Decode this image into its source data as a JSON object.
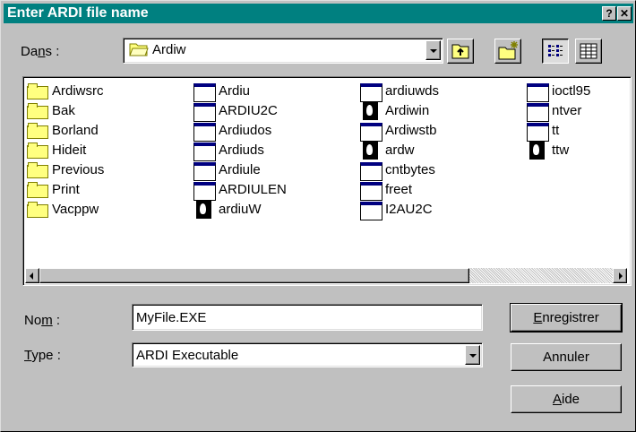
{
  "window": {
    "title": "Enter ARDI file name",
    "help_button": "?",
    "close_button": "✕"
  },
  "location": {
    "label_pre": "Da",
    "label_ul": "n",
    "label_post": "s :",
    "value": "Ardiw"
  },
  "files": {
    "columns": [
      [
        {
          "name": "Ardiwsrc",
          "type": "folder"
        },
        {
          "name": "Bak",
          "type": "folder"
        },
        {
          "name": "Borland",
          "type": "folder"
        },
        {
          "name": "Hideit",
          "type": "folder"
        },
        {
          "name": "Previous",
          "type": "folder"
        },
        {
          "name": "Print",
          "type": "folder"
        },
        {
          "name": "Vacppw",
          "type": "folder"
        }
      ],
      [
        {
          "name": "Ardiu",
          "type": "exe"
        },
        {
          "name": "ARDIU2C",
          "type": "exe"
        },
        {
          "name": "Ardiudos",
          "type": "exe"
        },
        {
          "name": "Ardiuds",
          "type": "exe"
        },
        {
          "name": "Ardiule",
          "type": "exe"
        },
        {
          "name": "ARDIULEN",
          "type": "exe"
        },
        {
          "name": "ardiuW",
          "type": "app"
        }
      ],
      [
        {
          "name": "ardiuwds",
          "type": "exe"
        },
        {
          "name": "Ardiwin",
          "type": "app"
        },
        {
          "name": "Ardiwstb",
          "type": "exe"
        },
        {
          "name": "ardw",
          "type": "app"
        },
        {
          "name": "cntbytes",
          "type": "exe"
        },
        {
          "name": "freet",
          "type": "exe"
        },
        {
          "name": "I2AU2C",
          "type": "exe"
        }
      ],
      [
        {
          "name": "ioctl95",
          "type": "exe"
        },
        {
          "name": "ntver",
          "type": "exe"
        },
        {
          "name": "tt",
          "type": "exe"
        },
        {
          "name": "ttw",
          "type": "app"
        }
      ]
    ]
  },
  "filename": {
    "label_pre": "No",
    "label_ul": "m",
    "label_post": " :",
    "value": "MyFile.EXE"
  },
  "filetype": {
    "label_pre": "",
    "label_ul": "T",
    "label_post": "ype :",
    "value": "ARDI Executable"
  },
  "buttons": {
    "save": {
      "ul": "E",
      "rest": "nregistrer"
    },
    "cancel": {
      "label": "Annuler"
    },
    "help": {
      "ul": "A",
      "rest": "ide"
    }
  },
  "colors": {
    "titlebar": "#008080",
    "face": "#c0c0c0",
    "folder": "#ffff80"
  }
}
